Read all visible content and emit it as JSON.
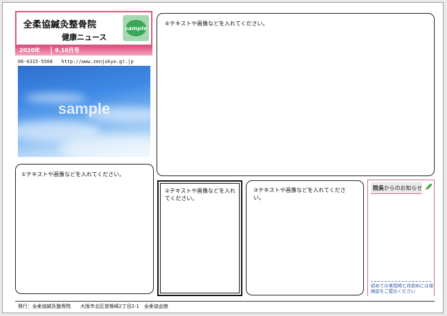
{
  "header": {
    "clinic_name": "全柔協鍼灸整骨院",
    "news_title": "健康ニュース",
    "logo_text": "sample",
    "year": "2020年",
    "issue": "9.10月号"
  },
  "contact": {
    "phone": "06-6315-5560",
    "url": "http://www.zenjukyo.gr.jp"
  },
  "image": {
    "watermark": "sample"
  },
  "panels": {
    "p6": "⑥テキストや画像などを入れてください。",
    "p1": "①テキストや画像などを入れてください。",
    "p2": "②テキストや画像などを入れてください。",
    "p3": "③テキストや画像などを入れてください。"
  },
  "notice": {
    "title_strong": "院長",
    "title_rest": "からのお知らせ",
    "note": "初めての来院時と月初めには保険証をご提示ください"
  },
  "footer": {
    "text": "発行：全柔協鍼灸整骨院　　大阪市北区曽根崎2丁目2-1　全柔協会館"
  },
  "colors": {
    "accent_pink": "#d05a7c",
    "note_blue": "#2a56a0",
    "logo_green": "#3aa65a"
  }
}
